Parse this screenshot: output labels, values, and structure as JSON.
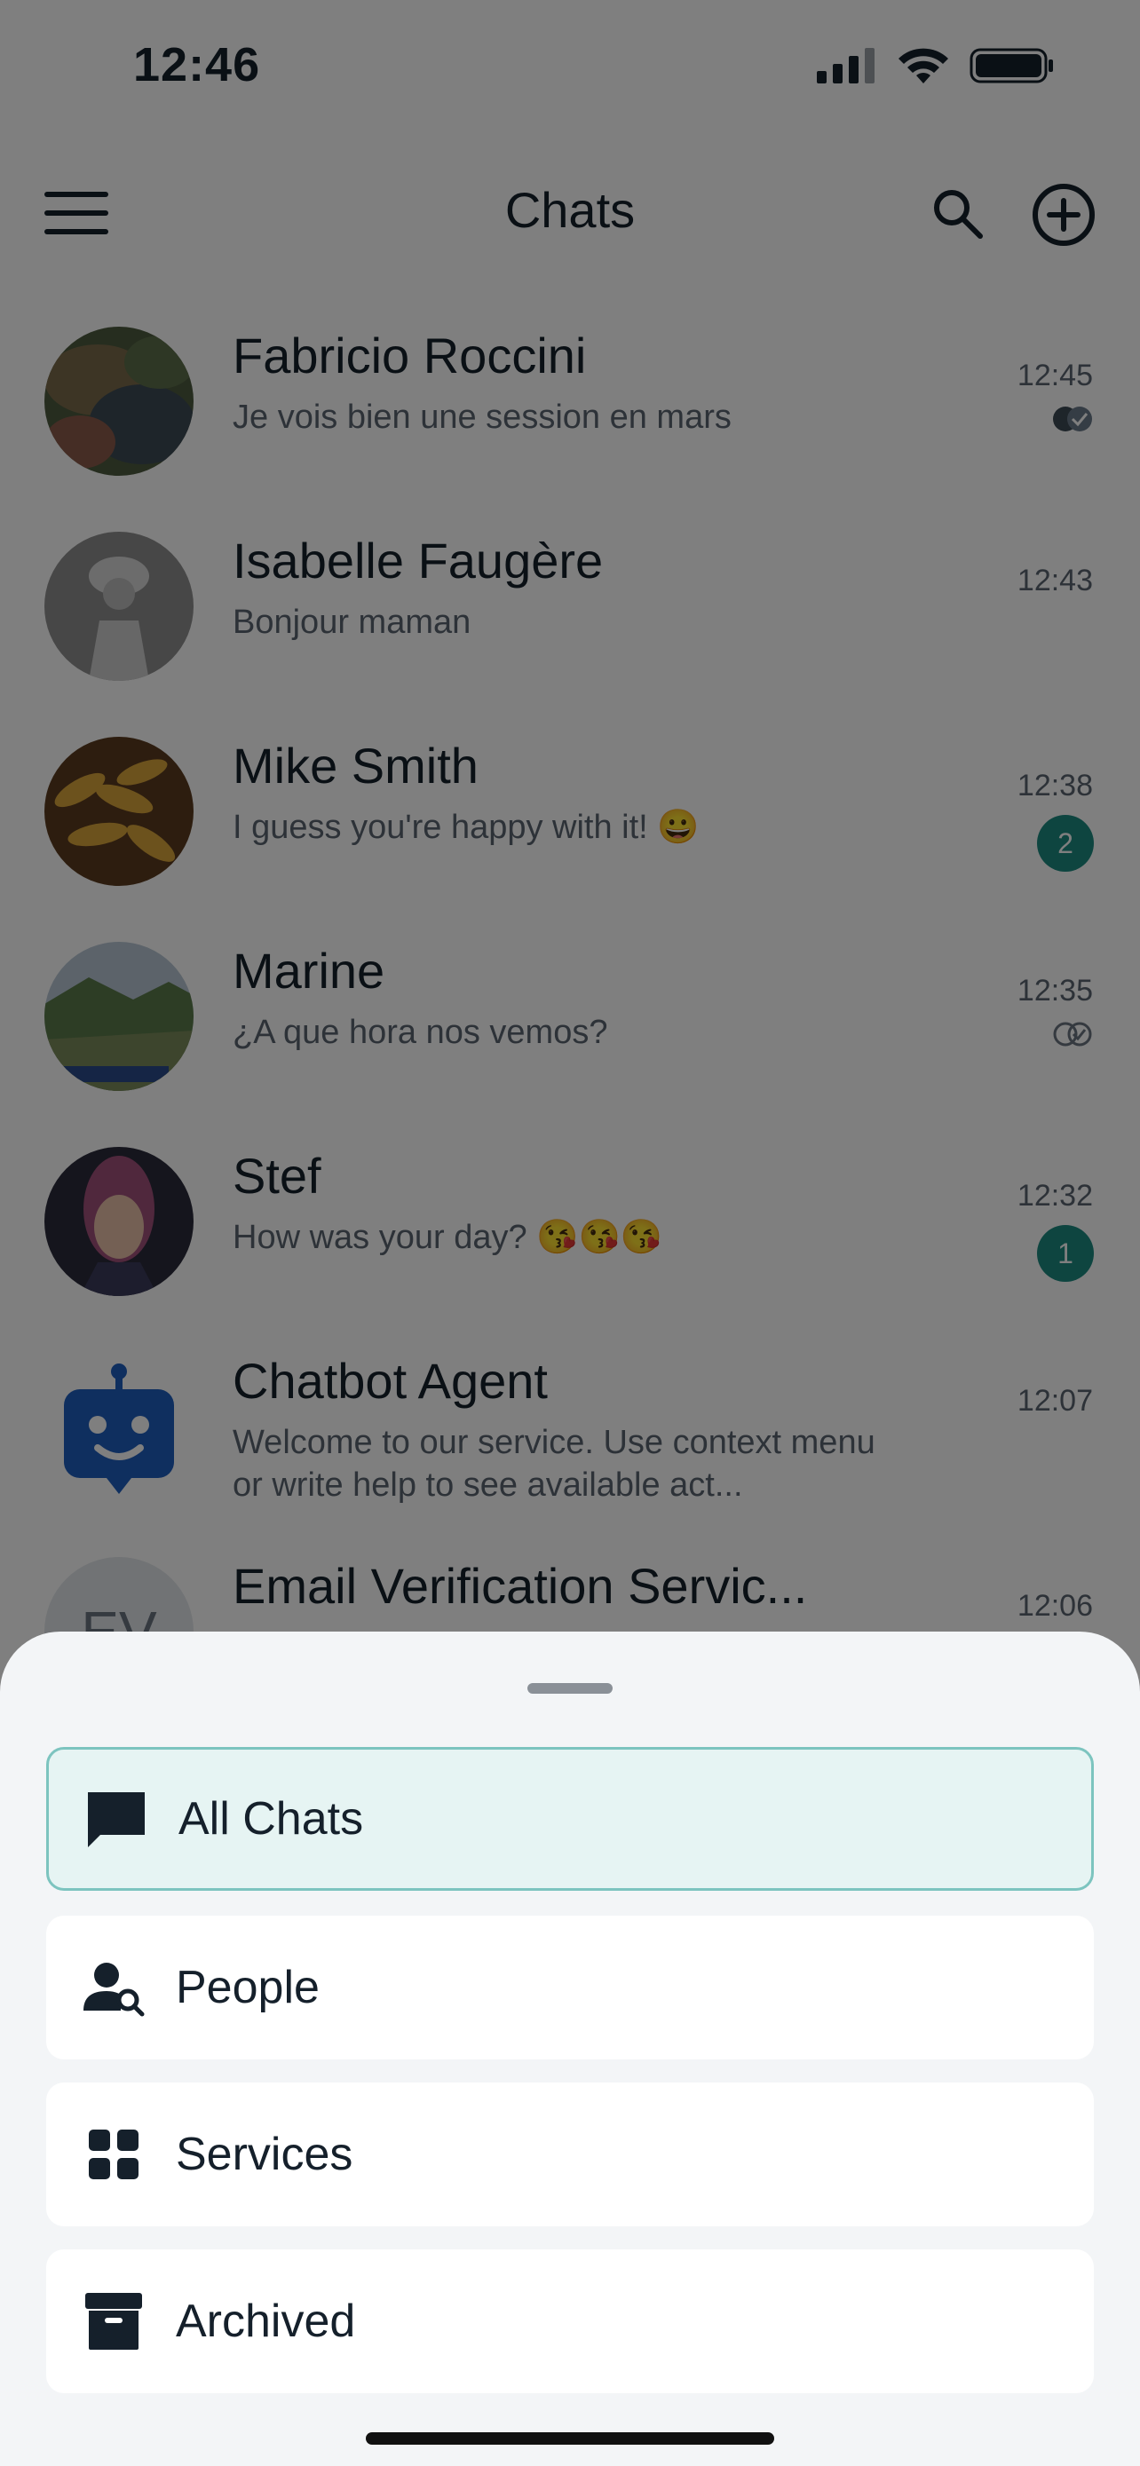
{
  "status_bar": {
    "time": "12:46"
  },
  "header": {
    "title": "Chats"
  },
  "chats": [
    {
      "name": "Fabricio Roccini",
      "preview": "Je vois bien une session en mars",
      "time": "12:45",
      "status": "read",
      "avatar": "coral-reef-photo"
    },
    {
      "name": "Isabelle Faugère",
      "preview": "Bonjour maman",
      "time": "12:43",
      "status": "none",
      "avatar": "vintage-portrait-photo"
    },
    {
      "name": "Mike Smith",
      "preview": "I guess you're happy with it!",
      "preview_emoji": "😀",
      "time": "12:38",
      "unread": "2",
      "avatar": "bananas-photo"
    },
    {
      "name": "Marine",
      "preview": "¿A que hora nos vemos?",
      "time": "12:35",
      "status": "delivered",
      "avatar": "mountain-landscape-photo"
    },
    {
      "name": "Stef",
      "preview": "How was your day?",
      "preview_emoji": "😘😘😘",
      "time": "12:32",
      "unread": "1",
      "avatar": "portrait-art-photo"
    },
    {
      "name": "Chatbot Agent",
      "preview": "Welcome to our service. Use context menu or write help to see available act...",
      "time": "12:07",
      "avatar": "robot-icon"
    },
    {
      "name": "Email Verification Servic...",
      "preview": "",
      "time": "12:06",
      "avatar_initials": "EV"
    }
  ],
  "filters": [
    {
      "label": "All Chats",
      "icon": "chat-bubble-icon",
      "active": true
    },
    {
      "label": "People",
      "icon": "person-search-icon",
      "active": false
    },
    {
      "label": "Services",
      "icon": "grid-icon",
      "active": false
    },
    {
      "label": "Archived",
      "icon": "archive-box-icon",
      "active": false
    }
  ],
  "colors": {
    "accent": "#1c8a80",
    "active_filter_bg": "#e6f4f3",
    "active_filter_border": "#7cc4bf",
    "sheet_bg": "#f3f5f7",
    "text": "#15202b"
  }
}
